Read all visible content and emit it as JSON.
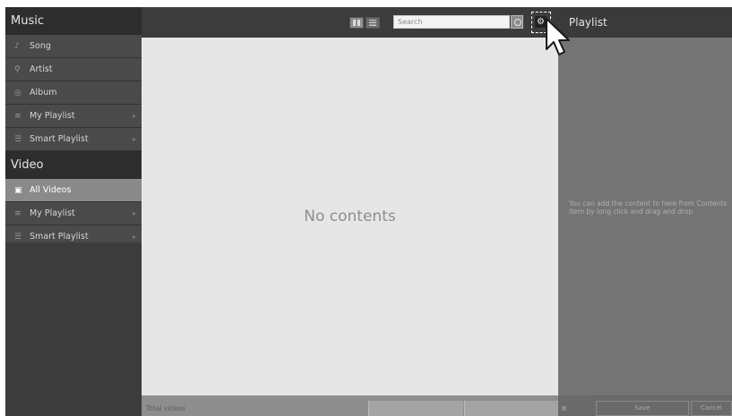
{
  "sidebar": {
    "music_title": "Music",
    "music_items": [
      {
        "icon": "music-note-icon",
        "label": "Song",
        "has_submenu": false
      },
      {
        "icon": "person-icon",
        "label": "Artist",
        "has_submenu": false
      },
      {
        "icon": "disc-icon",
        "label": "Album",
        "has_submenu": false
      },
      {
        "icon": "playlist-icon",
        "label": "My Playlist",
        "has_submenu": true
      },
      {
        "icon": "smart-playlist-icon",
        "label": "Smart Playlist",
        "has_submenu": true
      }
    ],
    "video_title": "Video",
    "video_items": [
      {
        "icon": "video-icon",
        "label": "All Videos",
        "selected": true,
        "has_submenu": false
      },
      {
        "icon": "playlist-icon",
        "label": "My Playlist",
        "selected": false,
        "has_submenu": true
      },
      {
        "icon": "smart-playlist-icon",
        "label": "Smart Playlist",
        "selected": false,
        "has_submenu": true
      }
    ]
  },
  "toolbar": {
    "grid_view_icon": "grid-view-icon",
    "list_view_icon": "list-view-icon",
    "search_placeholder": "Search",
    "search_icon": "search-icon",
    "settings_icon": "gear-icon"
  },
  "main": {
    "empty_text": "No contents",
    "bottom_label": "Total videos"
  },
  "playlist": {
    "title": "Playlist",
    "hint": "You can add the content to here from Contents item by long click and drag and drop",
    "button_labels": [
      "Save",
      "Cancel"
    ]
  },
  "colors": {
    "sidebar_bg": "#3a3a3a",
    "selected_item": "#8a8a8a",
    "content_bg": "#e6e6e6",
    "playlist_bg": "#747474"
  }
}
